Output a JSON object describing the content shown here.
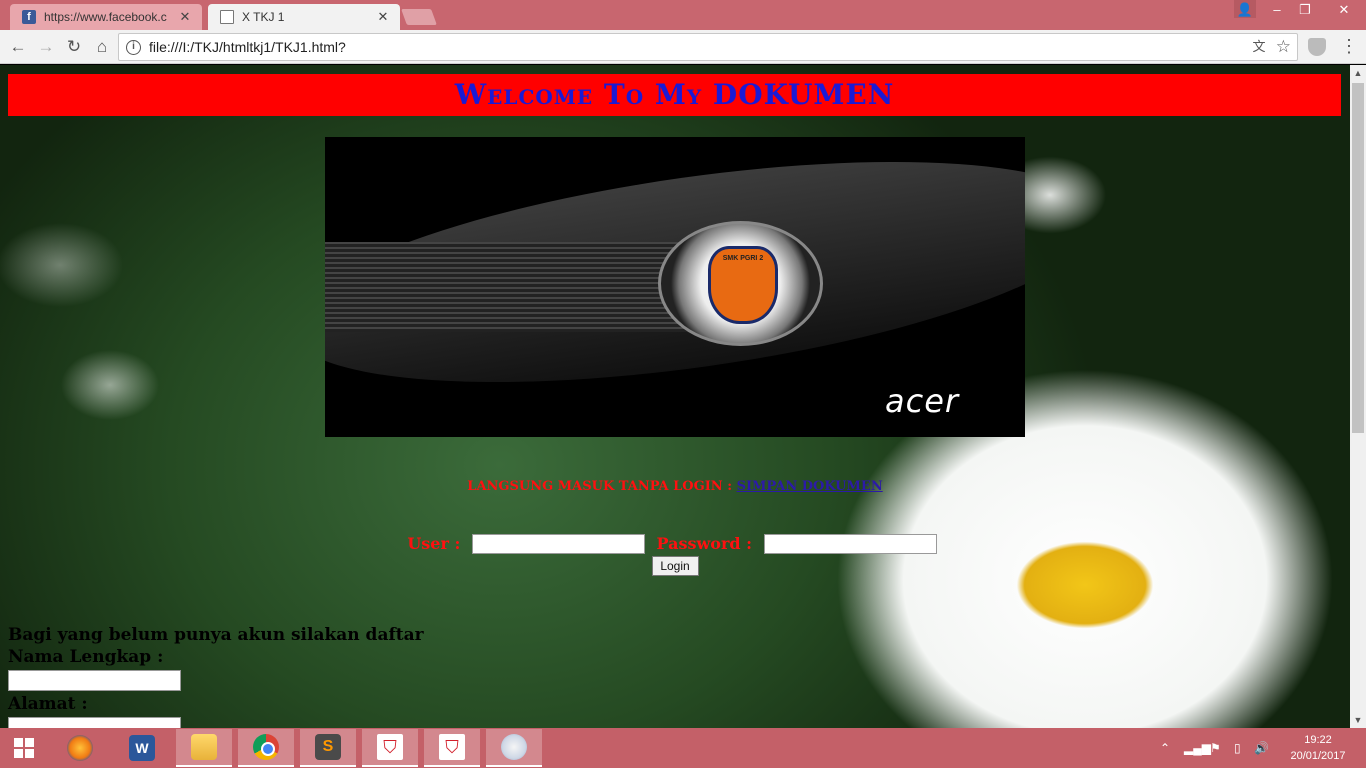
{
  "browser": {
    "tabs": [
      {
        "label": "https://www.facebook.c",
        "favicon": "facebook-icon",
        "active": false
      },
      {
        "label": "X TKJ 1",
        "favicon": "document-icon",
        "active": true
      }
    ],
    "url": "file:///I:/TKJ/htmltkj1/TKJ1.html?"
  },
  "page": {
    "banner_title": "Welcome To My DOKUMEN",
    "banner_colors": {
      "background": "#ff0000",
      "text": "#1a1ad6"
    },
    "hero_logo_text": "SMK PGRI 2",
    "hero_brand": "acer",
    "visit_text": "LANGSUNG MASUK TANPA LOGIN",
    "visit_sep": ":",
    "visit_link": "SIMPAN DOKUMEN",
    "login": {
      "user_label": "User :",
      "password_label": "Password :",
      "button": "Login"
    },
    "register": {
      "heading": "Bagi yang belum punya akun silakan daftar",
      "name_label": "Nama Lengkap :",
      "address_label": "Alamat :"
    }
  },
  "taskbar": {
    "clock_time": "19:22",
    "clock_date": "20/01/2017",
    "apps": [
      "windows-start",
      "firefox",
      "word",
      "file-explorer",
      "chrome",
      "sublime-text",
      "shield-app",
      "shield-app",
      "paint"
    ]
  }
}
